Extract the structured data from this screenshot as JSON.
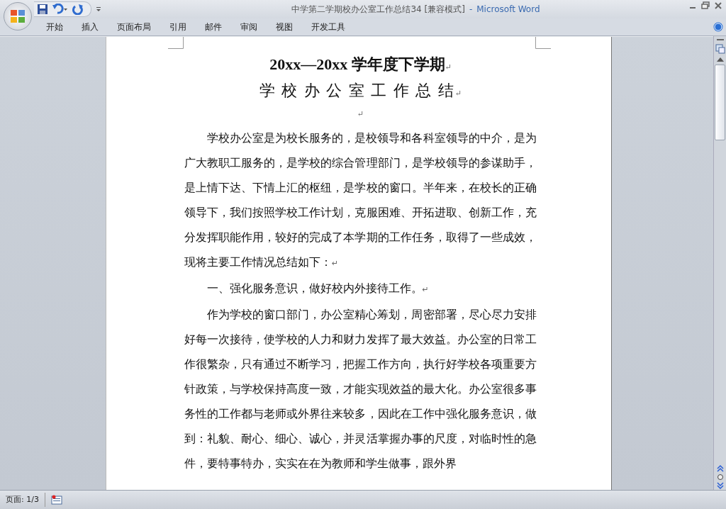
{
  "window": {
    "title": "中学第二学期校办公室工作总结34 [兼容模式]",
    "separator": "-",
    "app_name": "Microsoft Word"
  },
  "ribbon_tabs": [
    {
      "label": "开始"
    },
    {
      "label": "插入"
    },
    {
      "label": "页面布局"
    },
    {
      "label": "引用"
    },
    {
      "label": "邮件"
    },
    {
      "label": "审阅"
    },
    {
      "label": "视图"
    },
    {
      "label": "开发工具"
    }
  ],
  "document": {
    "title_lines": [
      {
        "text": "20xx—20xx 学年度下学期",
        "end_mark": "↵"
      },
      {
        "text": "学 校 办 公 室 工 作 总 结",
        "end_mark": "↵"
      }
    ],
    "paragraphs": [
      {
        "end_mark": "↵"
      },
      {
        "text": "学校办公室是为校长服务的，是校领导和各科室领导的中介，是为广大教职工服务的，是学校的综合管理部门，是学校领导的参谋助手，是上情下达、下情上汇的枢纽，是学校的窗口。半年来，在校长的正确领导下，我们按照学校工作计划，克服困难、开拓进取、创新工作，充分发挥职能作用，较好的完成了本学期的工作任务，取得了一些成效，现将主要工作情况总结如下：",
        "end_mark": "↵"
      },
      {
        "text": "一、强化服务意识，做好校内外接待工作。",
        "end_mark": "↵"
      },
      {
        "text": "作为学校的窗口部门，办公室精心筹划，周密部署，尽心尽力安排好每一次接待，使学校的人力和财力发挥了最大效益。办公室的日常工作很繁杂，只有通过不断学习，把握工作方向，执行好学校各项重要方针政策，与学校保持高度一致，才能实现效益的最大化。办公室很多事务性的工作都与老师或外界往来较多，因此在工作中强化服务意识，做到：礼貌、耐心、细心、诚心，并灵活掌握办事的尺度，对临时性的急件，要特事特办，实实在在为教师和学生做事，跟外界"
      }
    ]
  },
  "status_bar": {
    "page": "页面: 1/3"
  }
}
